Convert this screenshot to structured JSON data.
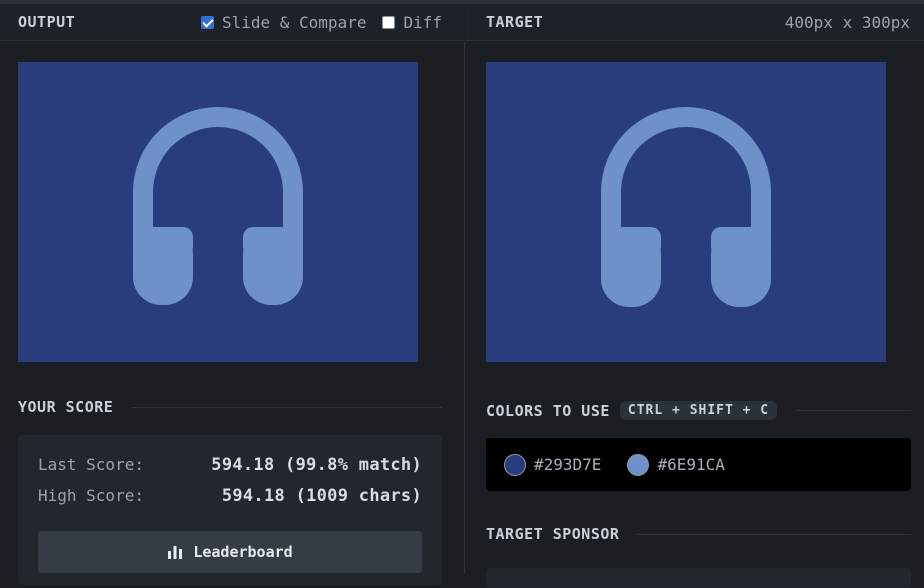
{
  "output_panel": {
    "title": "OUTPUT",
    "slide_compare": {
      "label": "Slide & Compare",
      "checked": true
    },
    "diff": {
      "label": "Diff",
      "checked": false
    }
  },
  "target_panel": {
    "title": "TARGET",
    "dimensions": "400px x 300px"
  },
  "score": {
    "heading": "YOUR SCORE",
    "last_label": "Last Score:",
    "last_value": "594.18 (99.8% match)",
    "high_label": "High Score:",
    "high_value": "594.18 (1009 chars)",
    "leaderboard_label": "Leaderboard"
  },
  "colors": {
    "heading": "COLORS TO USE",
    "shortcut": "CTRL + SHIFT + C",
    "items": [
      {
        "hex": "#293D7E",
        "label": "#293D7E"
      },
      {
        "hex": "#6E91CA",
        "label": "#6E91CA"
      }
    ]
  },
  "sponsor": {
    "heading": "TARGET SPONSOR"
  },
  "canvas_colors": {
    "background": "#293D7E",
    "foreground": "#6E91CA"
  },
  "icons": [
    "headphones-icon",
    "bar-chart-icon"
  ]
}
